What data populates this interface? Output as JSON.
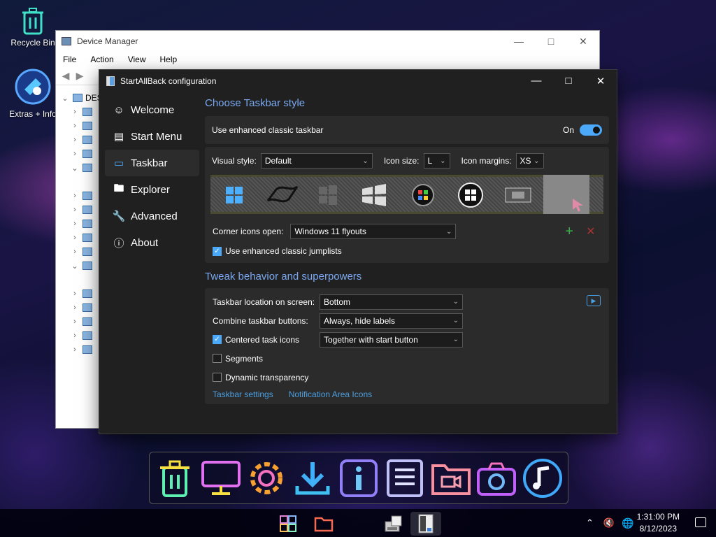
{
  "desktop": {
    "icons": [
      {
        "label": "Recycle Bin"
      },
      {
        "label": "Extras + Info"
      }
    ]
  },
  "device_manager": {
    "title": "Device Manager",
    "menu": [
      "File",
      "Action",
      "View",
      "Help"
    ],
    "tree_root": "DES"
  },
  "sab": {
    "title": "StartAllBack configuration",
    "nav": [
      {
        "label": "Welcome",
        "icon": "smile-icon"
      },
      {
        "label": "Start Menu",
        "icon": "start-menu-icon"
      },
      {
        "label": "Taskbar",
        "icon": "taskbar-icon"
      },
      {
        "label": "Explorer",
        "icon": "folder-icon"
      },
      {
        "label": "Advanced",
        "icon": "wrench-icon"
      },
      {
        "label": "About",
        "icon": "info-icon"
      }
    ],
    "active_nav": "Taskbar",
    "section1_title": "Choose Taskbar style",
    "enhanced_taskbar_label": "Use enhanced classic taskbar",
    "enhanced_taskbar_state": "On",
    "visual_style_label": "Visual style:",
    "visual_style_value": "Default",
    "icon_size_label": "Icon size:",
    "icon_size_value": "L",
    "icon_margins_label": "Icon margins:",
    "icon_margins_value": "XS",
    "corner_icons_label": "Corner icons open:",
    "corner_icons_value": "Windows 11 flyouts",
    "jumplists_label": "Use enhanced classic jumplists",
    "section2_title": "Tweak behavior and superpowers",
    "location_label": "Taskbar location on screen:",
    "location_value": "Bottom",
    "combine_label": "Combine taskbar buttons:",
    "combine_value": "Always, hide labels",
    "centered_label": "Centered task icons",
    "centered_value": "Together with start button",
    "segments_label": "Segments",
    "dynamic_label": "Dynamic transparency",
    "link_taskbar_settings": "Taskbar settings",
    "link_notification_icons": "Notification Area Icons"
  },
  "taskbar": {
    "time": "1:31:00 PM",
    "date": "8/12/2023"
  },
  "colors": {
    "accent": "#4ca8f8",
    "section_title": "#7aa8f0",
    "link": "#4c9fe0",
    "window_bg": "#202020",
    "card_bg": "#2b2b2b"
  }
}
